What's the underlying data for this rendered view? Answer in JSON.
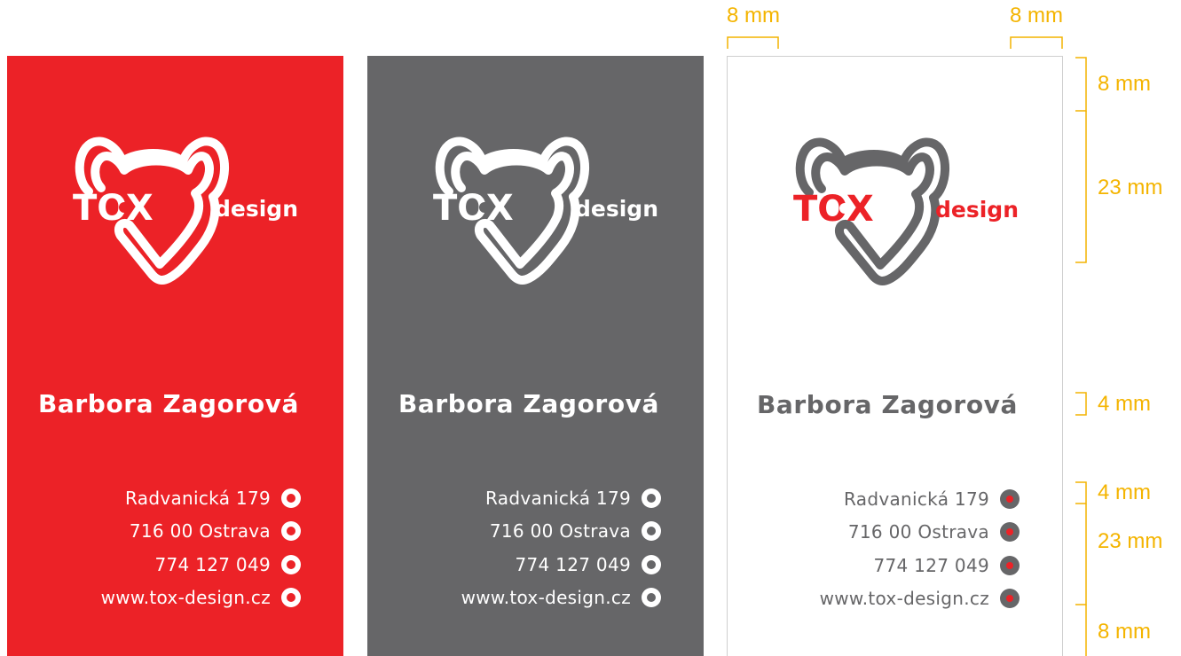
{
  "colors": {
    "brand_red": "#ec2227",
    "brand_grey": "#666668",
    "dimension": "#f4b400"
  },
  "logo": {
    "mark": "TOX",
    "word": "design"
  },
  "cards": [
    {
      "variant": "red",
      "name": "Barbora Zagorová",
      "contacts": [
        "Radvanická 179",
        "716 00 Ostrava",
        "774 127 049",
        "www.tox-design.cz"
      ]
    },
    {
      "variant": "grey",
      "name": "Barbora Zagorová",
      "contacts": [
        "Radvanická 179",
        "716 00 Ostrava",
        "774 127 049",
        "www.tox-design.cz"
      ]
    },
    {
      "variant": "white",
      "name": "Barbora Zagorová",
      "contacts": [
        "Radvanická 179",
        "716 00 Ostrava",
        "774 127 049",
        "www.tox-design.cz"
      ]
    }
  ],
  "dimensions": {
    "top_left_margin": "8 mm",
    "top_right_margin": "8 mm",
    "right_top_margin": "8 mm",
    "right_logo_height": "23 mm",
    "right_name_height": "4 mm",
    "right_gap": "4 mm",
    "right_contacts_height": "23 mm",
    "right_bottom_margin": "8 mm"
  }
}
